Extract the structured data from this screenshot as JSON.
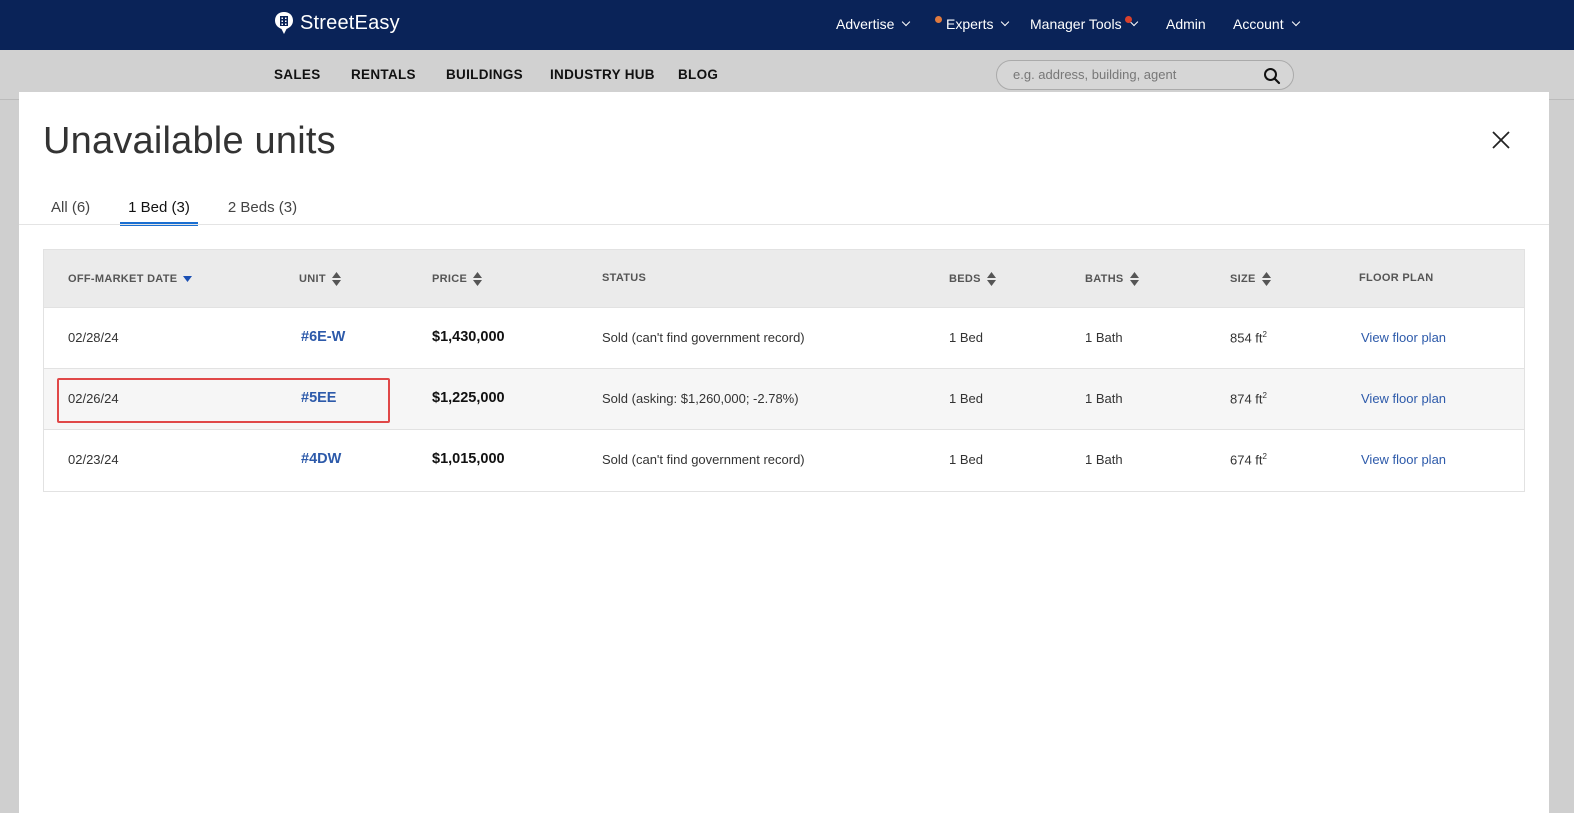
{
  "brand": {
    "name": "StreetEasy"
  },
  "topnav": {
    "advertise": "Advertise",
    "experts": "Experts",
    "manager_tools": "Manager Tools",
    "admin": "Admin",
    "account": "Account"
  },
  "subnav": {
    "sales": "SALES",
    "rentals": "RENTALS",
    "buildings": "BUILDINGS",
    "industry_hub": "INDUSTRY HUB",
    "blog": "BLOG",
    "search_placeholder": "e.g. address, building, agent"
  },
  "modal": {
    "title": "Unavailable units",
    "tabs": [
      {
        "label": "All (6)"
      },
      {
        "label": "1 Bed (3)"
      },
      {
        "label": "2 Beds (3)"
      }
    ],
    "active_tab": "1 Bed (3)",
    "columns": {
      "date": "OFF-MARKET DATE",
      "unit": "UNIT",
      "price": "PRICE",
      "status": "STATUS",
      "beds": "BEDS",
      "baths": "BATHS",
      "size": "SIZE",
      "floor_plan": "FLOOR PLAN"
    },
    "rows": [
      {
        "date": "02/28/24",
        "unit": "#6E-W",
        "price": "$1,430,000",
        "status": "Sold (can't find government record)",
        "beds": "1 Bed",
        "baths": "1 Bath",
        "size": "854 ft",
        "floor_plan": "View floor plan"
      },
      {
        "date": "02/26/24",
        "unit": "#5EE",
        "price": "$1,225,000",
        "status": "Sold (asking: $1,260,000; -2.78%)",
        "beds": "1 Bed",
        "baths": "1 Bath",
        "size": "874 ft",
        "floor_plan": "View floor plan"
      },
      {
        "date": "02/23/24",
        "unit": "#4DW",
        "price": "$1,015,000",
        "status": "Sold (can't find government record)",
        "beds": "1 Bed",
        "baths": "1 Bath",
        "size": "674 ft",
        "floor_plan": "View floor plan"
      }
    ],
    "size_superscript": "2"
  },
  "colors": {
    "navbar": "#0a2358",
    "accent": "#1a6fd1",
    "link": "#2d5aaa",
    "highlight": "#e04848",
    "experts_dot": "#e07a3f",
    "manager_dot": "#d9412c"
  },
  "icons": {
    "logo": "streeteasy-logo-icon",
    "search": "search-icon",
    "close": "close-icon",
    "sort": "sort-icon",
    "sort_desc": "sort-desc-icon",
    "chevron": "chevron-down-icon"
  }
}
